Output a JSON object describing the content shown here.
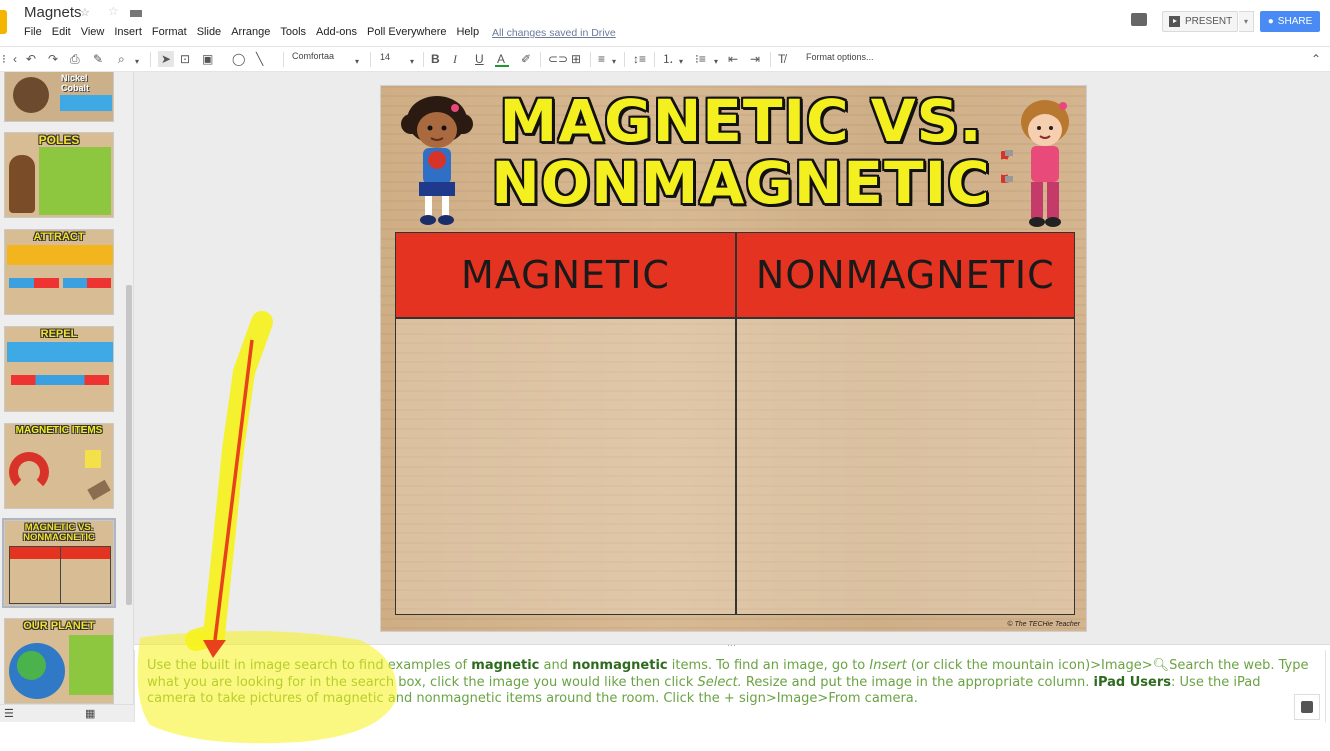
{
  "app": {
    "doc_title": "Magnets",
    "saved_status": "All changes saved in Drive",
    "menu": [
      "File",
      "Edit",
      "View",
      "Insert",
      "Format",
      "Slide",
      "Arrange",
      "Tools",
      "Add-ons",
      "Poll Everywhere",
      "Help"
    ],
    "present_label": "PRESENT",
    "share_label": "SHARE"
  },
  "toolbar": {
    "font": "Comfortaa",
    "font_size": "14",
    "format_options": "Format options..."
  },
  "filmstrip": {
    "slides": [
      {
        "title": "Nickel Cobalt"
      },
      {
        "title": "POLES"
      },
      {
        "title": "ATTRACT"
      },
      {
        "title": "REPEL"
      },
      {
        "title": "MAGNETIC ITEMS"
      },
      {
        "title": "MAGNETIC VS. NONMAGNETIC"
      },
      {
        "title": "OUR PLANET"
      }
    ],
    "selected_index": 5
  },
  "slide": {
    "title_line1": "MAGNETIC VS.",
    "title_line2": "NONMAGNETIC",
    "col1": "MAGNETIC",
    "col2": "NONMAGNETIC",
    "credit": "© The TECHie Teacher"
  },
  "notes": {
    "p1": "Use the built in image search to find examples of ",
    "b1": "magnetic",
    "p2": " and ",
    "b2": "nonmagnetic",
    "p3": " items. To find an image, go to ",
    "i1": "Insert",
    "p4": " (or click the mountain icon)>Image>",
    "p5": "Search the web. Type what you are looking for in the search box, click the image you would like then click ",
    "i2": "Select.",
    "p6": " Resize and put the image in the appropriate column. ",
    "b3": "iPad Users",
    "p7": ": Use the iPad camera to take pictures of magnetic and nonmagnetic items around the room. Click the + sign>Image>From camera."
  },
  "colors": {
    "accent": "#4a8af4",
    "header_red": "#e53322",
    "title_yellow": "#f4f020",
    "notes_green": "#6aa343",
    "highlight": "#f7f21a",
    "arrow": "#e8421d"
  }
}
